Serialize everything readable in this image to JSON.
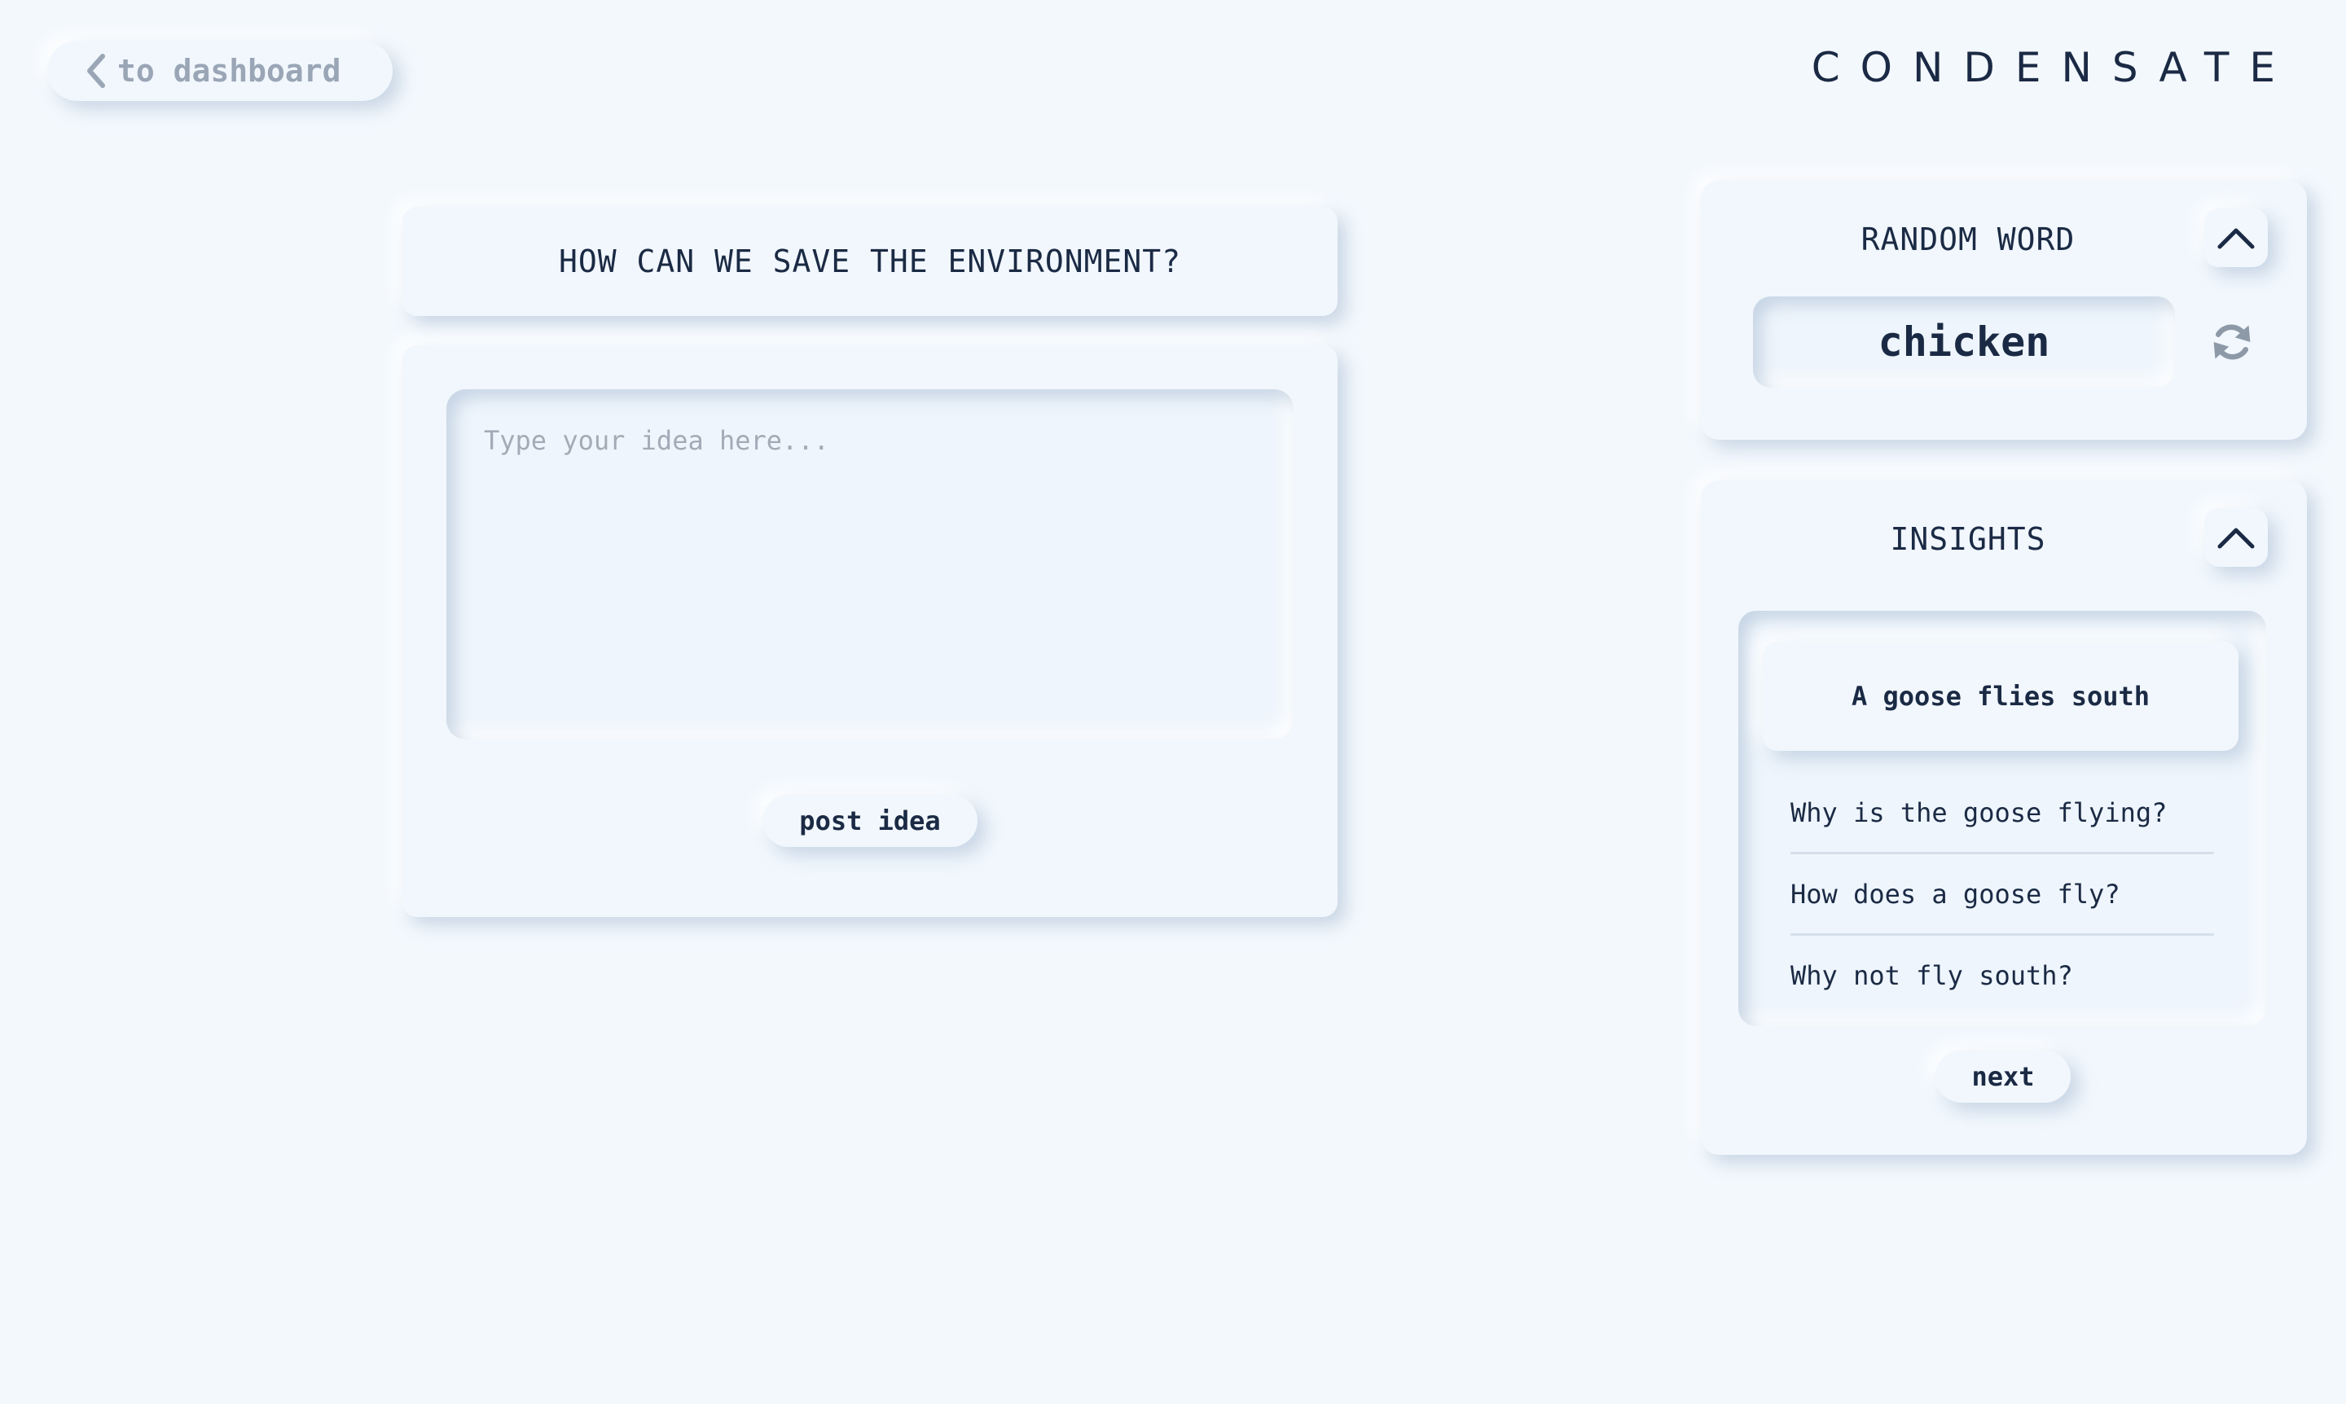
{
  "topbar": {
    "back_label": "to dashboard",
    "back_icon": "chevron-left-icon",
    "brand": "CONDENSATE"
  },
  "prompt": {
    "question": "HOW CAN WE SAVE THE ENVIRONMENT?",
    "idea_placeholder": "Type your idea here...",
    "idea_value": "",
    "post_label": "post idea"
  },
  "random_word": {
    "title": "RANDOM WORD",
    "word": "chicken",
    "collapse_icon": "chevron-up-icon",
    "refresh_icon": "refresh-icon"
  },
  "insights": {
    "title": "INSIGHTS",
    "collapse_icon": "chevron-up-icon",
    "heading": "A goose flies south",
    "items": [
      "Why is the goose flying?",
      "How does a goose fly?",
      "Why not fly south?"
    ],
    "next_label": "next"
  },
  "colors": {
    "background": "#f3f8fd",
    "text": "#1b2a44",
    "muted": "#9aa6b6",
    "divider": "#d4dfea"
  }
}
